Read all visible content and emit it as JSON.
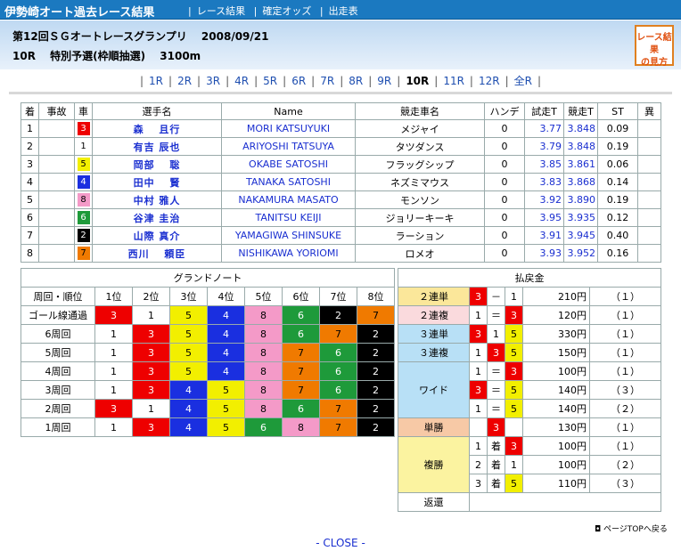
{
  "header": {
    "site_title": "伊勢崎オート過去レース結果",
    "nav": [
      "レース結果",
      "確定オッズ",
      "出走表"
    ],
    "race_line1": "第12回ＳＧオートレースグランプリ　 2008/09/21",
    "race_line2": "10R　 特別予選(枠順抽選)　 3100m",
    "howto_line1": "レース結果",
    "howto_line2": "の見方"
  },
  "race_nav": {
    "items": [
      "1R",
      "2R",
      "3R",
      "4R",
      "5R",
      "6R",
      "7R",
      "8R",
      "9R",
      "10R",
      "11R",
      "12R",
      "全R"
    ],
    "current": "10R"
  },
  "results": {
    "headers": [
      "着",
      "事故",
      "車",
      "選手名",
      "Name",
      "競走車名",
      "ハンデ",
      "試走T",
      "競走T",
      "ST",
      "異"
    ],
    "rows": [
      {
        "rank": "1",
        "accident": "",
        "car": "3",
        "name": "森　 且行",
        "romaji": "MORI KATSUYUKI",
        "machine": "メジャイ",
        "handicap": "0",
        "trial_t": "3.77",
        "race_t": "3.848",
        "st": "0.09",
        "flag": ""
      },
      {
        "rank": "2",
        "accident": "",
        "car": "1",
        "name": "有吉 辰也",
        "romaji": "ARIYOSHI TATSUYA",
        "machine": "タツダンス",
        "handicap": "0",
        "trial_t": "3.79",
        "race_t": "3.848",
        "st": "0.19",
        "flag": ""
      },
      {
        "rank": "3",
        "accident": "",
        "car": "5",
        "name": "岡部　 聡",
        "romaji": "OKABE SATOSHI",
        "machine": "フラッグシップ",
        "handicap": "0",
        "trial_t": "3.85",
        "race_t": "3.861",
        "st": "0.06",
        "flag": ""
      },
      {
        "rank": "4",
        "accident": "",
        "car": "4",
        "name": "田中　 賢",
        "romaji": "TANAKA SATOSHI",
        "machine": "ネズミマウス",
        "handicap": "0",
        "trial_t": "3.83",
        "race_t": "3.868",
        "st": "0.14",
        "flag": ""
      },
      {
        "rank": "5",
        "accident": "",
        "car": "8",
        "name": "中村 雅人",
        "romaji": "NAKAMURA MASATO",
        "machine": "モンソン",
        "handicap": "0",
        "trial_t": "3.92",
        "race_t": "3.890",
        "st": "0.19",
        "flag": ""
      },
      {
        "rank": "6",
        "accident": "",
        "car": "6",
        "name": "谷津 圭治",
        "romaji": "TANITSU KEIJI",
        "machine": "ジョリーキーキ",
        "handicap": "0",
        "trial_t": "3.95",
        "race_t": "3.935",
        "st": "0.12",
        "flag": ""
      },
      {
        "rank": "7",
        "accident": "",
        "car": "2",
        "name": "山際 真介",
        "romaji": "YAMAGIWA SHINSUKE",
        "machine": "ラーション",
        "handicap": "0",
        "trial_t": "3.91",
        "race_t": "3.945",
        "st": "0.40",
        "flag": ""
      },
      {
        "rank": "8",
        "accident": "",
        "car": "7",
        "name": "西川　 頼臣",
        "romaji": "NISHIKAWA YORIOMI",
        "machine": "ロメオ",
        "handicap": "0",
        "trial_t": "3.93",
        "race_t": "3.952",
        "st": "0.16",
        "flag": ""
      }
    ]
  },
  "grand_note": {
    "title": "グランドノート",
    "headers": [
      "周回・順位",
      "1位",
      "2位",
      "3位",
      "4位",
      "5位",
      "6位",
      "7位",
      "8位"
    ],
    "rows": [
      {
        "label": "ゴール線通過",
        "cars": [
          "3",
          "1",
          "5",
          "4",
          "8",
          "6",
          "2",
          "7"
        ]
      },
      {
        "label": "6周回",
        "cars": [
          "1",
          "3",
          "5",
          "4",
          "8",
          "6",
          "7",
          "2"
        ]
      },
      {
        "label": "5周回",
        "cars": [
          "1",
          "3",
          "5",
          "4",
          "8",
          "7",
          "6",
          "2"
        ]
      },
      {
        "label": "4周回",
        "cars": [
          "1",
          "3",
          "5",
          "4",
          "8",
          "7",
          "6",
          "2"
        ]
      },
      {
        "label": "3周回",
        "cars": [
          "1",
          "3",
          "4",
          "5",
          "8",
          "7",
          "6",
          "2"
        ]
      },
      {
        "label": "2周回",
        "cars": [
          "3",
          "1",
          "4",
          "5",
          "8",
          "6",
          "7",
          "2"
        ]
      },
      {
        "label": "1周回",
        "cars": [
          "1",
          "3",
          "4",
          "5",
          "6",
          "8",
          "7",
          "2"
        ]
      }
    ]
  },
  "payout": {
    "title": "払戻金",
    "rows": [
      {
        "bet": "２連単",
        "bet_color": "#fbe79a",
        "a": "3",
        "op1": "－",
        "b": "1",
        "op2": "",
        "c": "",
        "yen": "210円",
        "pop": "（１）"
      },
      {
        "bet": "２連複",
        "bet_color": "#fadadd",
        "a": "1",
        "op1": "＝",
        "b": "3",
        "op2": "",
        "c": "",
        "yen": "120円",
        "pop": "（１）"
      },
      {
        "bet": "３連単",
        "bet_color": "#b8e0f6",
        "a": "3",
        "op1": "1",
        "b": "5",
        "op2": "",
        "c": "",
        "yen": "330円",
        "pop": "（１）"
      },
      {
        "bet": "３連複",
        "bet_color": "#b8e0f6",
        "a": "1",
        "op1": "3",
        "b": "5",
        "op2": "",
        "c": "",
        "yen": "150円",
        "pop": "（１）"
      }
    ],
    "wide": {
      "bet": "ワイド",
      "bet_color": "#b8e0f6",
      "rows": [
        {
          "a": "1",
          "op": "＝",
          "b": "3",
          "yen": "100円",
          "pop": "（１）"
        },
        {
          "a": "3",
          "op": "＝",
          "b": "5",
          "yen": "140円",
          "pop": "（３）"
        },
        {
          "a": "1",
          "op": "＝",
          "b": "5",
          "yen": "140円",
          "pop": "（２）"
        }
      ]
    },
    "tansho": {
      "bet": "単勝",
      "bet_color": "#f7c9a6",
      "car": "3",
      "yen": "130円",
      "pop": "（１）"
    },
    "fukusho": {
      "bet": "複勝",
      "bet_color": "#fbf3a0",
      "rows": [
        {
          "rank": "1",
          "label": "着",
          "car": "3",
          "yen": "100円",
          "pop": "（１）"
        },
        {
          "rank": "2",
          "label": "着",
          "car": "1",
          "yen": "100円",
          "pop": "（２）"
        },
        {
          "rank": "3",
          "label": "着",
          "car": "5",
          "yen": "110円",
          "pop": "（３）"
        }
      ]
    },
    "henkan": {
      "bet": "返還",
      "value": ""
    }
  },
  "footer": {
    "pagetop": "ページTOPへ戻る",
    "close": "- CLOSE -"
  },
  "colors": {
    "header_bar": "#1b79c0",
    "car_1": "#ffffff",
    "car_2": "#000000",
    "car_3": "#ee0000",
    "car_4": "#1a2fe0",
    "car_5": "#f2ef00",
    "car_6": "#1e9a3a",
    "car_7": "#f07a00",
    "car_8": "#f49ac8"
  }
}
